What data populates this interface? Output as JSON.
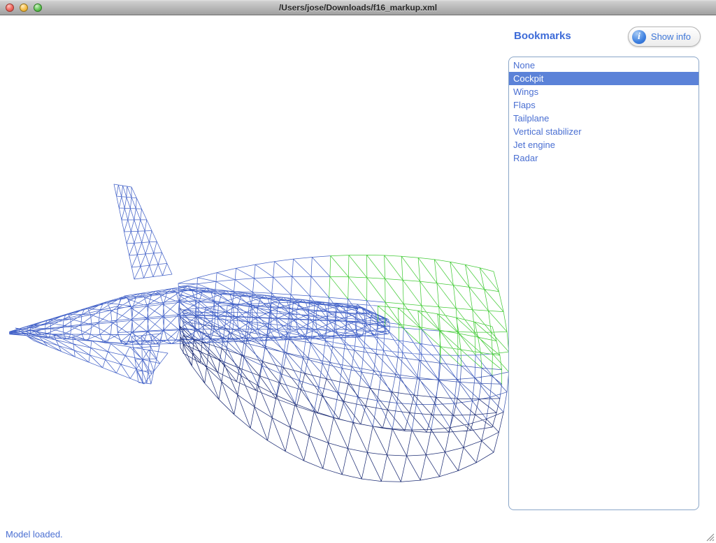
{
  "window": {
    "title": "/Users/jose/Downloads/f16_markup.xml"
  },
  "bookmarks_panel": {
    "title": "Bookmarks",
    "show_info_label": "Show info",
    "info_icon_glyph": "i",
    "items": [
      {
        "label": "None",
        "selected": false
      },
      {
        "label": "Cockpit",
        "selected": true
      },
      {
        "label": "Wings",
        "selected": false
      },
      {
        "label": "Flaps",
        "selected": false
      },
      {
        "label": "Tailplane",
        "selected": false
      },
      {
        "label": "Vertical stabilizer",
        "selected": false
      },
      {
        "label": "Jet engine",
        "selected": false
      },
      {
        "label": "Radar",
        "selected": false
      }
    ]
  },
  "viewport": {
    "wireframe_color": "#4463c8",
    "wireframe_mid_color": "#3a55b0",
    "wireframe_dark_color": "#1d2d74",
    "highlight_color": "#44cb38"
  },
  "status_bar": {
    "message": "Model loaded."
  }
}
